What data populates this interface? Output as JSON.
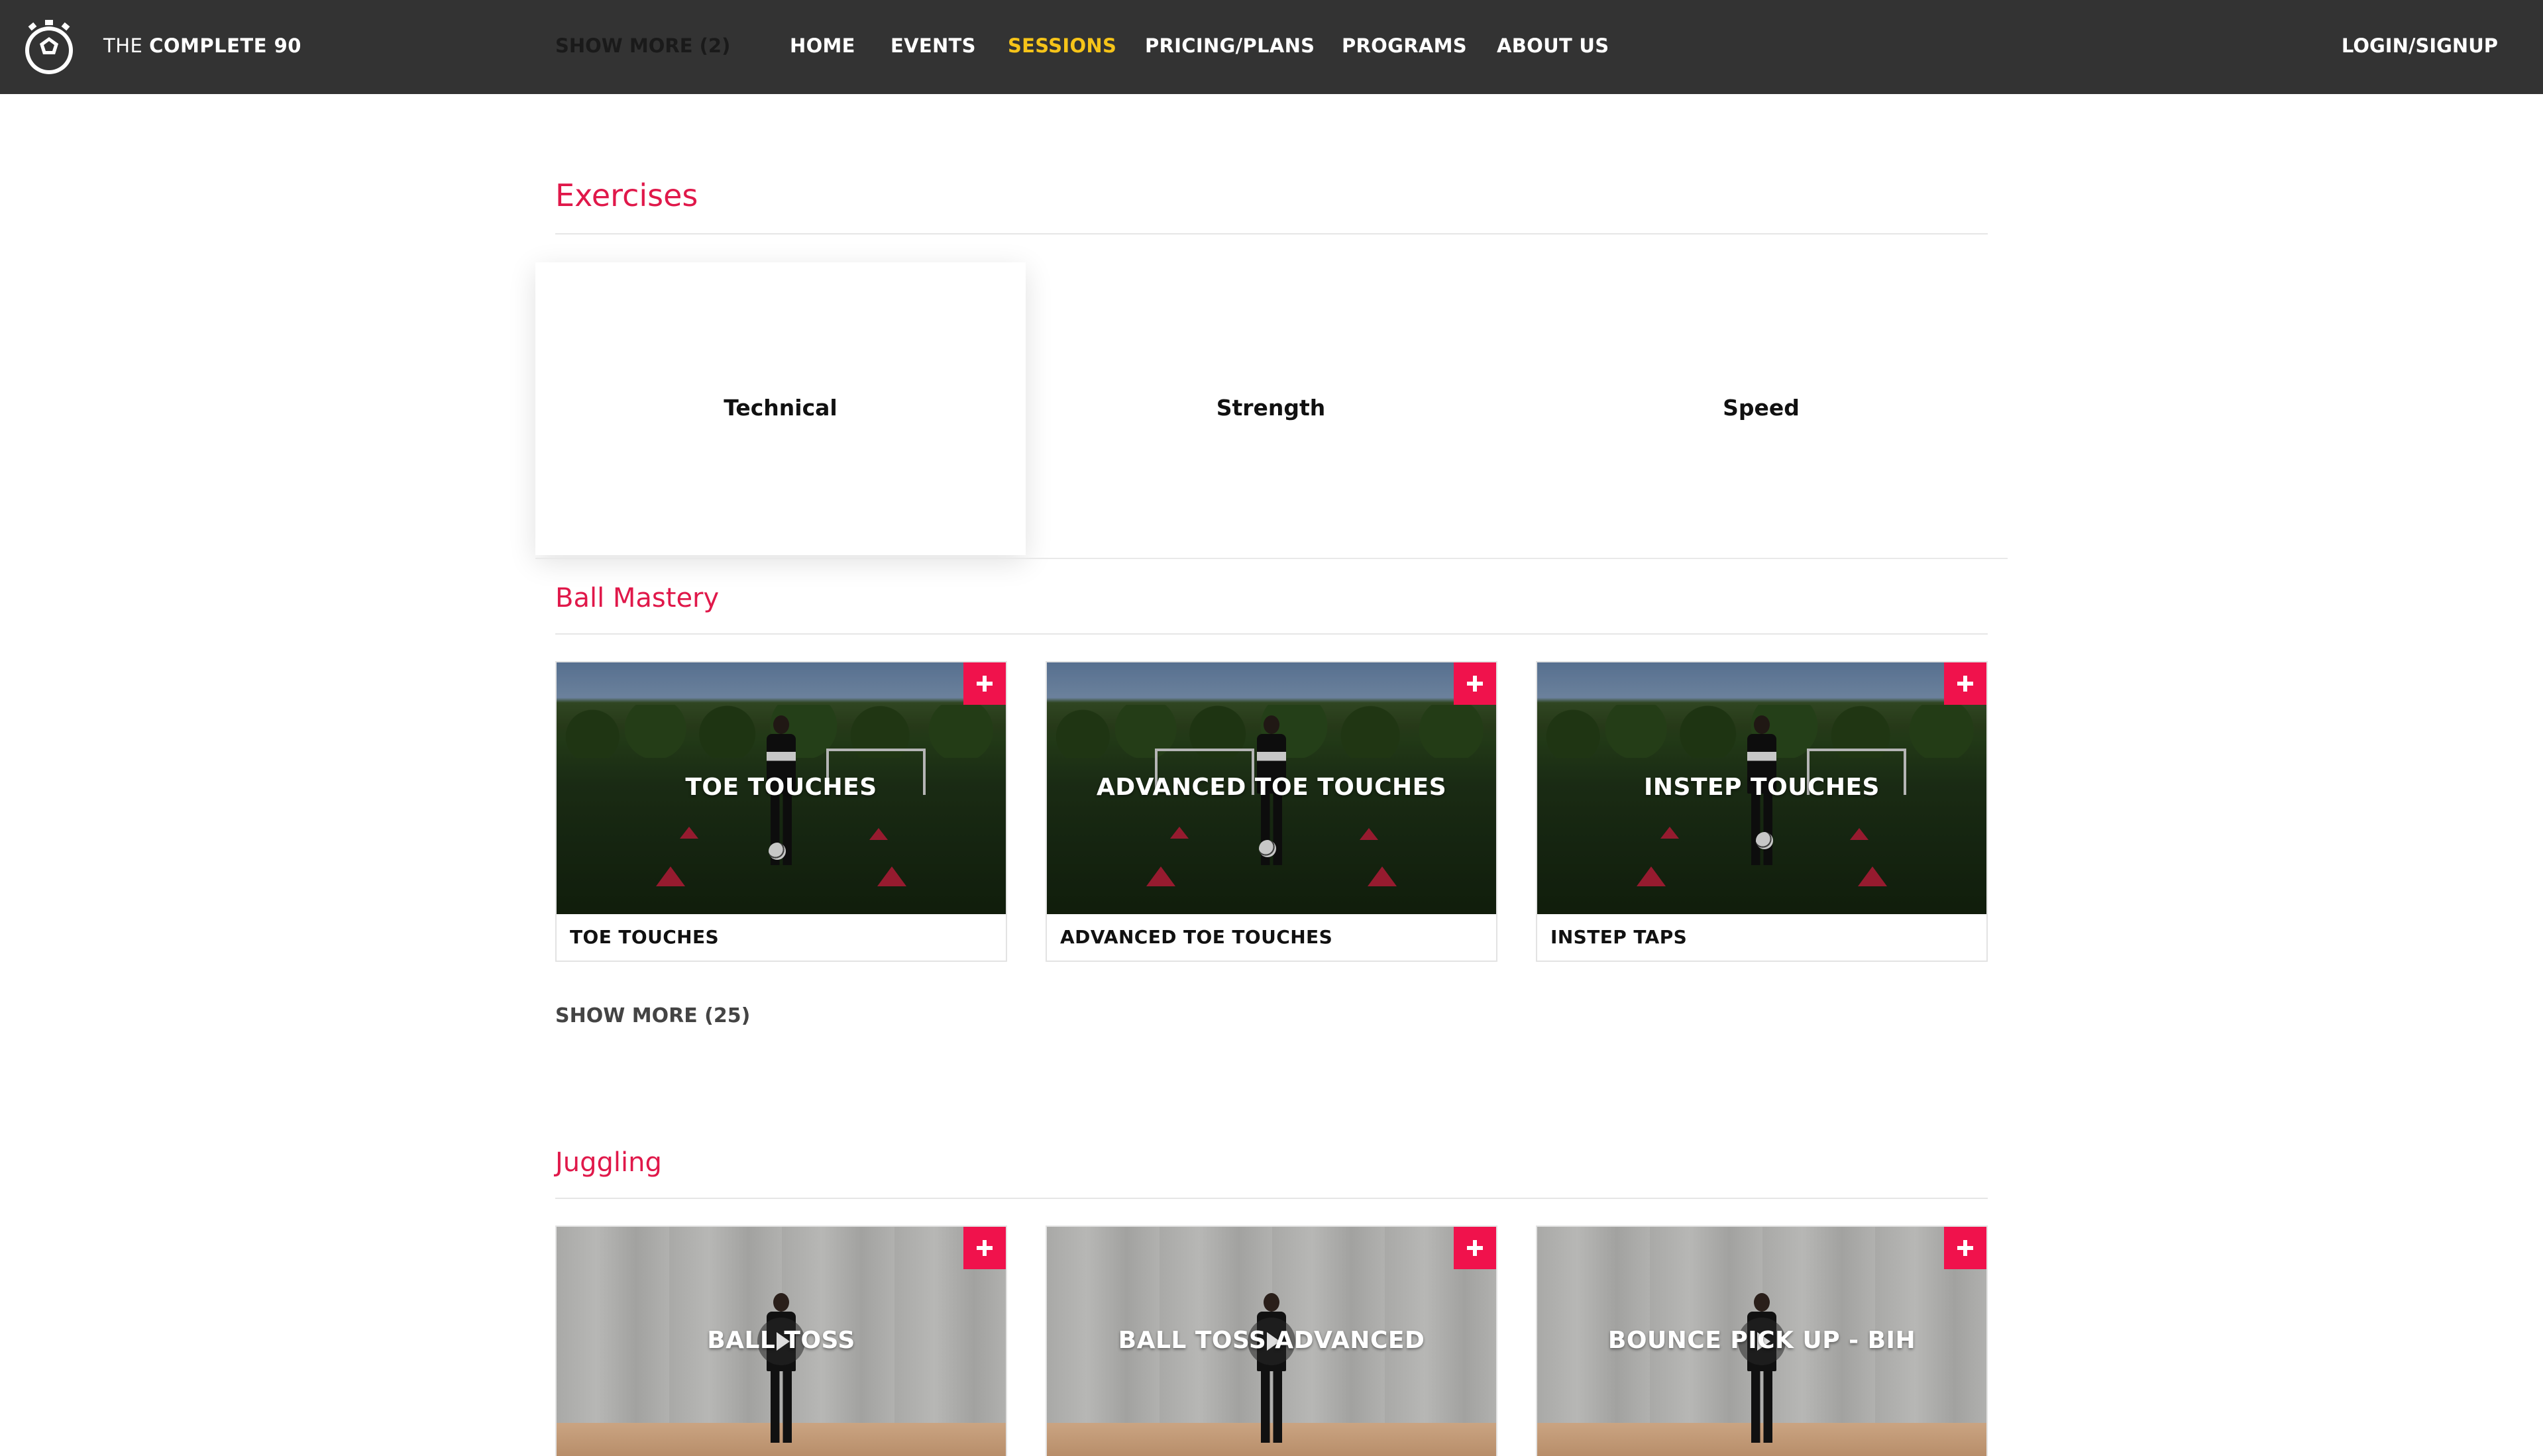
{
  "header": {
    "brand_prefix": "THE",
    "brand_name": "COMPLETE 90",
    "logo_icon": "soccer-ball-stopwatch-icon",
    "show_more_label": "SHOW MORE (2)",
    "nav": [
      {
        "label": "HOME",
        "active": false
      },
      {
        "label": "EVENTS",
        "active": false
      },
      {
        "label": "SESSIONS",
        "active": true
      },
      {
        "label": "PRICING/PLANS",
        "active": false
      },
      {
        "label": "PROGRAMS",
        "active": false
      },
      {
        "label": "ABOUT US",
        "active": false
      }
    ],
    "login_label": "LOGIN/SIGNUP"
  },
  "exercises": {
    "title": "Exercises",
    "categories": [
      {
        "label": "Technical",
        "selected": true
      },
      {
        "label": "Strength",
        "selected": false
      },
      {
        "label": "Speed",
        "selected": false
      }
    ]
  },
  "ball_mastery": {
    "title": "Ball Mastery",
    "cards": [
      {
        "overlay": "TOE TOUCHES",
        "caption": "TOE TOUCHES"
      },
      {
        "overlay": "ADVANCED TOE TOUCHES",
        "caption": "ADVANCED TOE TOUCHES"
      },
      {
        "overlay": "INSTEP TOUCHES",
        "caption": "INSTEP TAPS"
      }
    ],
    "show_more_label": "SHOW MORE (25)"
  },
  "juggling": {
    "title": "Juggling",
    "cards": [
      {
        "overlay": "BALL TOSS"
      },
      {
        "overlay": "BALL TOSS ADVANCED"
      },
      {
        "overlay": "BOUNCE PICK UP - BIH"
      }
    ]
  },
  "colors": {
    "nav_background": "#333333",
    "active_nav": "#f6c419",
    "accent_red": "#e0184a",
    "add_button": "#f0124c"
  }
}
